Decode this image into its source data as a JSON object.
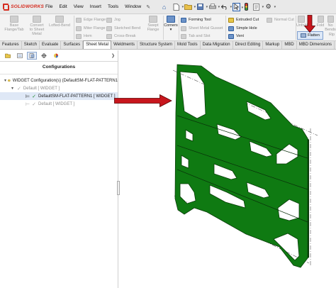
{
  "app": {
    "brand": "SOLIDWORKS"
  },
  "menu": {
    "items": [
      "File",
      "Edit",
      "View",
      "Insert",
      "Tools",
      "Window"
    ]
  },
  "commands": {
    "base_flange": [
      "Base",
      "Flange/Tab"
    ],
    "convert": [
      "Convert",
      "to Sheet",
      "Metal"
    ],
    "lofted_bend": [
      "Lofted-Bend"
    ],
    "edge_flange": "Edge Flange",
    "miter_flange": "Miter Flange",
    "hem": "Hem",
    "jog": "Jog",
    "sketched_bend": "Sketched Bend",
    "cross_break": "Cross-Break",
    "swept_flange": [
      "Swept",
      "Flange"
    ],
    "corners": "Corners",
    "forming_tool": "Forming Tool",
    "sheet_metal_gusset": "Sheet Metal Gusset",
    "tab_and_slot": "Tab and Slot",
    "extruded_cut": "Extruded Cut",
    "simple_hole": "Simple Hole",
    "vent": "Vent",
    "normal_cut": "Normal Cut",
    "unfold": "Unfold",
    "fold": "Fold",
    "no_bends": [
      "No",
      "Bends"
    ],
    "rip": "Rip",
    "flatten": "Flatten"
  },
  "tabs": [
    {
      "label": "Features",
      "active": false
    },
    {
      "label": "Sketch",
      "active": false
    },
    {
      "label": "Evaluate",
      "active": false
    },
    {
      "label": "Surfaces",
      "active": false
    },
    {
      "label": "Sheet Metal",
      "active": true
    },
    {
      "label": "Weldments",
      "active": false
    },
    {
      "label": "Structure System",
      "active": false
    },
    {
      "label": "Mold Tools",
      "active": false
    },
    {
      "label": "Data Migration",
      "active": false
    },
    {
      "label": "Direct Editing",
      "active": false
    },
    {
      "label": "Markup",
      "active": false
    },
    {
      "label": "MBD",
      "active": false
    },
    {
      "label": "MBD Dimensions",
      "active": false
    }
  ],
  "panel": {
    "title": "Configurations",
    "root": "WIDGET Configuration(s)  (DefaultSM-FLAT-PATTERN1",
    "default_config": "Default [ WIDGET ]",
    "flat_pattern": "DefaultSM-FLAT-PATTERN1 [ WIDGET ]",
    "sub_config": "Default [ WIDGET ]"
  },
  "colors": {
    "part_face": "#0f7a12",
    "part_edge": "#0a3d0a",
    "arrow": "#c8161d",
    "brand": "#d52b1e"
  }
}
